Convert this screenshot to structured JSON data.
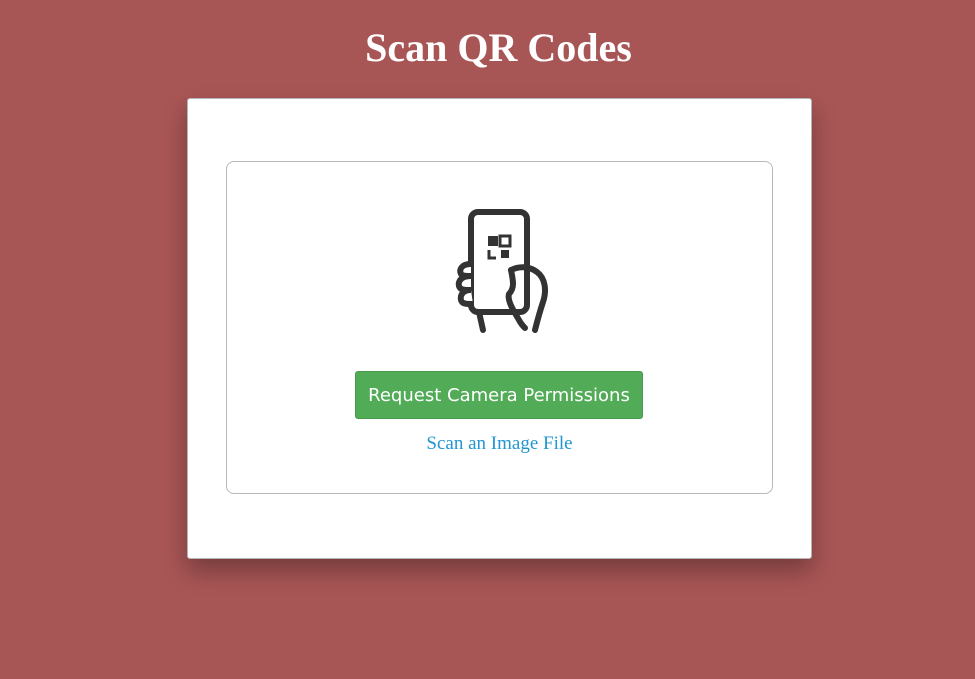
{
  "page": {
    "title": "Scan QR Codes"
  },
  "scanner": {
    "icon": "phone-qr-scan-icon",
    "camera_button_label": "Request Camera Permissions",
    "file_link_label": "Scan an Image File"
  },
  "colors": {
    "background": "#a85555",
    "button": "#52ab57",
    "link": "#2196d3",
    "icon": "#333333"
  }
}
